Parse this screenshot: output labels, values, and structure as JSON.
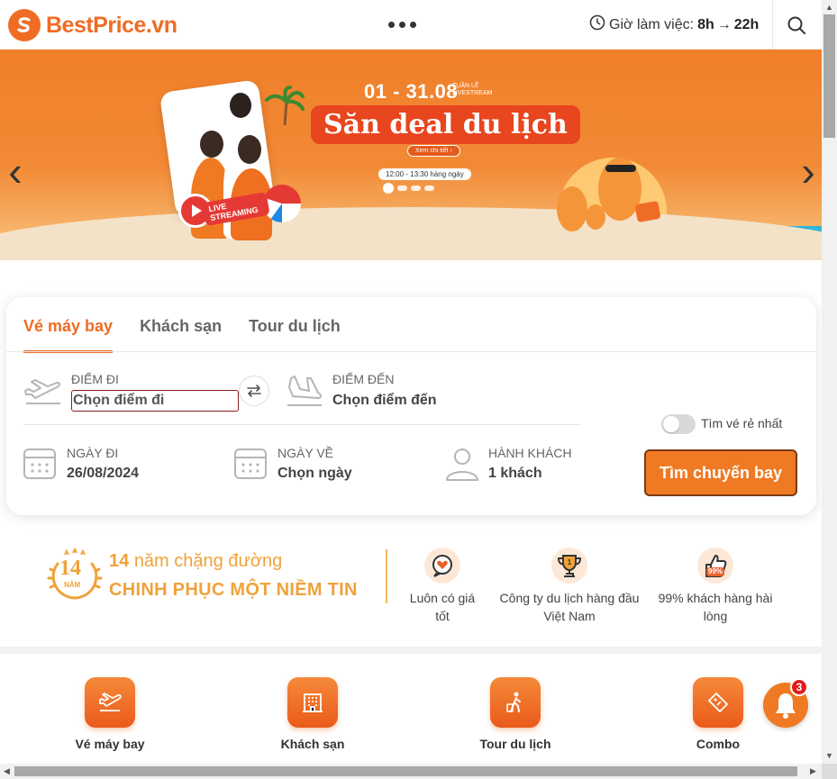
{
  "header": {
    "brand": "BestPrice.vn",
    "hours_label": "Giờ làm việc:",
    "hours_from": "8h",
    "hours_to": "22h"
  },
  "banner": {
    "dates": "01 - 31.08",
    "week_label": "TUẦN LỄ LIVESTREAM",
    "title": "Săn deal du lịch",
    "cta": "Xem chi tiết ›",
    "time": "12:00 - 13:30 hàng ngày",
    "live_label": "LIVE STREAMING",
    "slide_count": 4,
    "active_slide": 1
  },
  "search": {
    "tabs": [
      {
        "label": "Vé máy bay",
        "active": true
      },
      {
        "label": "Khách sạn",
        "active": false
      },
      {
        "label": "Tour du lịch",
        "active": false
      }
    ],
    "from": {
      "label": "ĐIỂM ĐI",
      "placeholder": "Chọn điểm đi",
      "value": ""
    },
    "to": {
      "label": "ĐIỂM ĐẾN",
      "value": "Chọn điểm đến"
    },
    "depart": {
      "label": "NGÀY ĐI",
      "value": "26/08/2024"
    },
    "return": {
      "label": "NGÀY VỀ",
      "value": "Chọn ngày"
    },
    "passengers": {
      "label": "HÀNH KHÁCH",
      "value": "1 khách"
    },
    "cheapest_toggle": {
      "label": "Tìm vé rẻ nhất",
      "on": false
    },
    "submit_label": "Tìm chuyến bay"
  },
  "trust": {
    "badge_number": "14",
    "badge_word": "NĂM",
    "years": "14",
    "line1_rest": "năm chặng đường",
    "line2": "CHINH PHỤC MỘT NIỀM TIN",
    "features": [
      {
        "label": "Luôn có giá tốt",
        "icon": "heart-chat-icon"
      },
      {
        "label": "Công ty du lịch hàng đầu Việt Nam",
        "icon": "trophy-icon"
      },
      {
        "label": "99% khách hàng hài lòng",
        "icon": "thumbs-up-icon",
        "badge": "99%"
      }
    ]
  },
  "quicknav": [
    {
      "label": "Vé máy bay",
      "icon": "plane-icon"
    },
    {
      "label": "Khách sạn",
      "icon": "hotel-icon"
    },
    {
      "label": "Tour du lịch",
      "icon": "traveler-icon"
    },
    {
      "label": "Combo",
      "icon": "combo-ticket-icon"
    }
  ],
  "notifications": {
    "count": "3"
  },
  "colors": {
    "brand": "#ef6c24",
    "accent_gold": "#f0a23a",
    "badge_red": "#e01b1b"
  }
}
